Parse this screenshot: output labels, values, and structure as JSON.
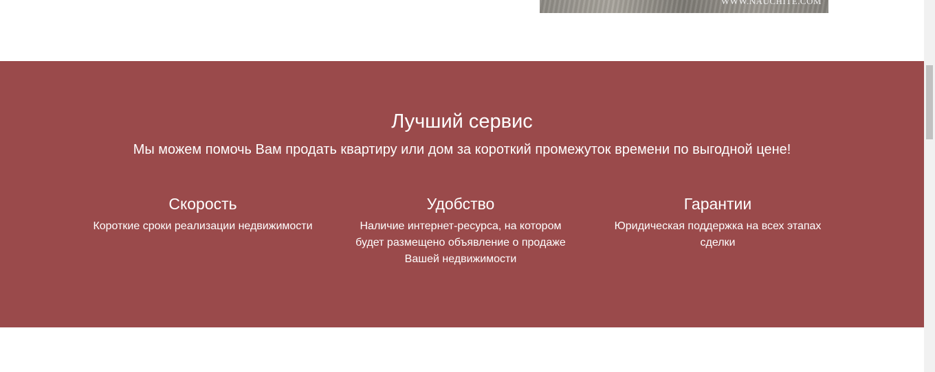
{
  "header_image": {
    "watermark": "WWW.NAUCHITE.COM"
  },
  "service": {
    "title": "Лучший сервис",
    "subtitle": "Мы можем помочь Вам продать квартиру или дом за короткий промежуток времени по выгодной цене!",
    "background_color": "#9a4a4b",
    "features": [
      {
        "title": "Скорость",
        "text": "Короткие сроки реализации недвижимости"
      },
      {
        "title": "Удобство",
        "text": "Наличие интернет-ресурса, на котором будет размещено объявление о продаже Вашей недвижимости"
      },
      {
        "title": "Гарантии",
        "text": "Юридическая поддержка на всех этапах сделки"
      }
    ]
  }
}
